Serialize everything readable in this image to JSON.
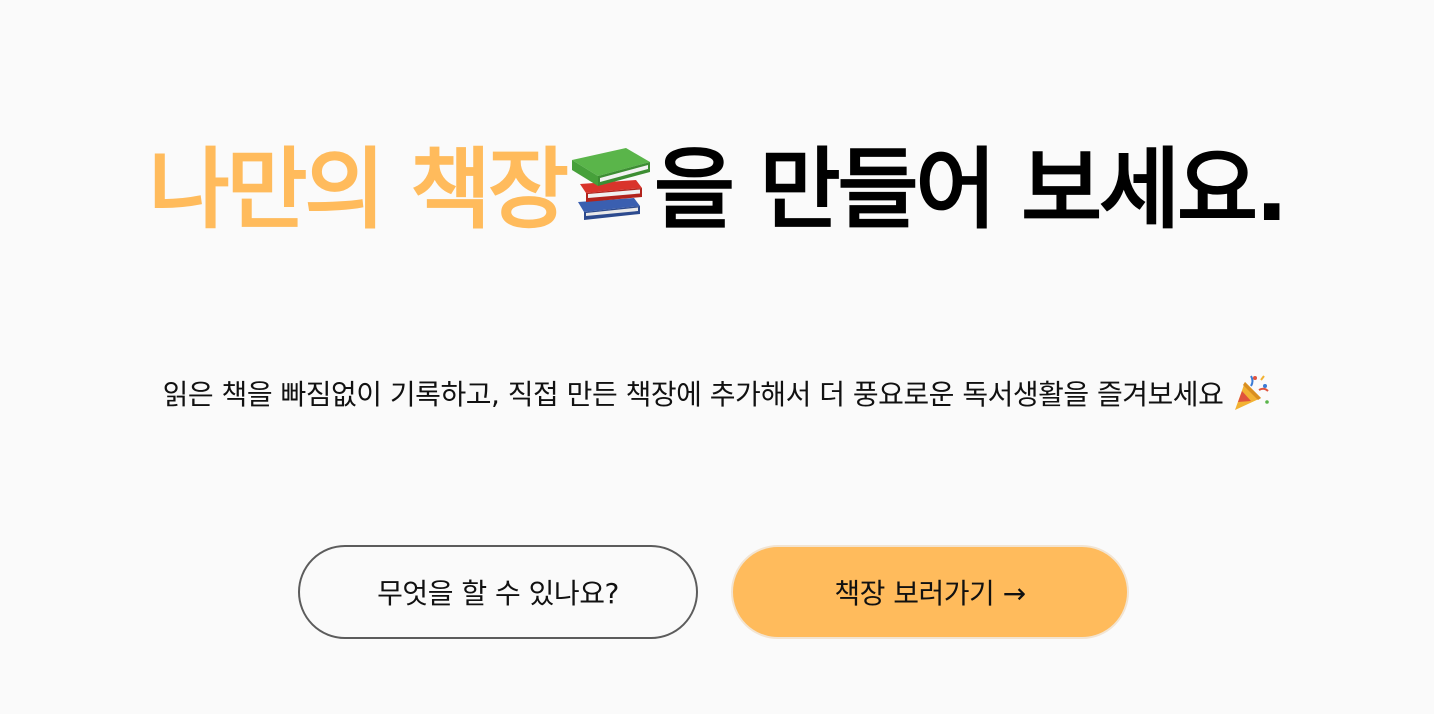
{
  "hero": {
    "title_accent": "나만의 책장",
    "title_rest": "을 만들어 보세요.",
    "emoji_icon": "books-icon"
  },
  "subtitle": {
    "text": "읽은 책을 빠짐없이 기록하고, 직접 만든 책장에 추가해서 더 풍요로운 독서생활을 즐겨보세요",
    "emoji_icon": "party-popper-icon"
  },
  "buttons": {
    "about_label": "무엇을 할 수 있나요?",
    "shelf_label": "책장 보러가기 →"
  },
  "colors": {
    "accent": "#ffbb5c",
    "background": "#fafafa",
    "text": "#000000",
    "outline_border": "#5c5c5c"
  }
}
